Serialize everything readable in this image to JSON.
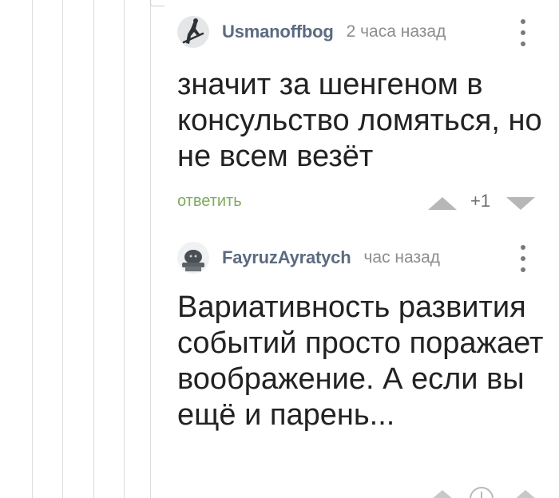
{
  "comments": [
    {
      "username": "Usmanoffbog",
      "timestamp": "2 часа назад",
      "text": "значит за шенгеном в консульство ломяться, но не всем везёт",
      "reply_label": "ответить",
      "rating": "+1",
      "avatar_icon": "skateboarder-avatar-icon"
    },
    {
      "username": "FayruzAyratych",
      "timestamp": "час назад",
      "text": "Вариативность развития событий просто поражает воображение. А если вы ещё и парень...",
      "avatar_icon": "statue-avatar-icon"
    }
  ],
  "colors": {
    "username": "#5b6b80",
    "timestamp": "#8d8d8d",
    "reply_link": "#7dac5a",
    "vote_arrow": "#b7b7b7",
    "thread_line": "#dcdcdc"
  }
}
